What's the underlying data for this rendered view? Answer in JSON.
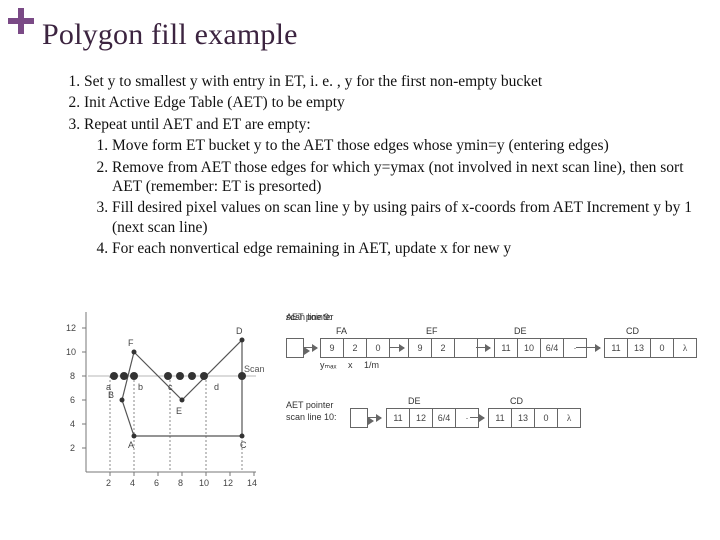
{
  "accent": "#6a3a78",
  "title": "Polygon fill example",
  "steps": [
    "Set y to smallest y with entry in ET, i. e. , y for the first non-empty bucket",
    "Init Active Edge Table (AET) to be empty",
    "Repeat until AET and ET are empty:"
  ],
  "substeps": [
    "Move form ET bucket y to the AET those edges whose ymin=y (entering edges)",
    "Remove from AET those edges for which y=ymax (not involved in next scan line), then sort AET (remember: ET is presorted)",
    "Fill desired pixel values on scan line y by using pairs of x-coords from AET Increment y by 1 (next scan line)",
    "For each nonvertical edge remaining in AET, update x for new y"
  ],
  "left_chart": {
    "x_ticks": [
      "2",
      "4",
      "6",
      "8",
      "10",
      "12",
      "14"
    ],
    "y_ticks": [
      "2",
      "4",
      "6",
      "8",
      "10",
      "12"
    ],
    "points": {
      "A": {
        "x": 4,
        "y": 3
      },
      "B": {
        "x": 3,
        "y": 6
      },
      "C": {
        "x": 13,
        "y": 3
      },
      "D": {
        "x": 13,
        "y": 11
      },
      "E": {
        "x": 8,
        "y": 6
      },
      "F": {
        "x": 4,
        "y": 10
      }
    },
    "scan_y": 8,
    "scan_dots": [
      "a",
      "b",
      "c",
      "d"
    ],
    "side_label": "Scan line"
  },
  "right": {
    "row1": {
      "line_label": "scan line 9:",
      "ptr_label": "AET pointer",
      "groups": [
        {
          "name": "FA",
          "cells": [
            "9",
            "2",
            "0"
          ]
        },
        {
          "name": "EF",
          "cells": [
            "9",
            "2",
            "",
            "."
          ]
        },
        {
          "name": "DE",
          "cells": [
            "11",
            "10",
            "6/4"
          ]
        },
        {
          "name": "CD",
          "cells": [
            "11",
            "13",
            "0"
          ],
          "endcell": "λ"
        }
      ],
      "foot_labels": [
        "yₘₐₓ",
        "x",
        "1/m"
      ]
    },
    "row2": {
      "line_label": "scan line 10:",
      "ptr_label": "AET pointer",
      "groups": [
        {
          "name": "DE",
          "cells": [
            "11",
            "12",
            "6/4"
          ]
        },
        {
          "name": "CD",
          "cells": [
            "11",
            "13",
            "0"
          ],
          "endcell": "λ"
        }
      ]
    }
  }
}
